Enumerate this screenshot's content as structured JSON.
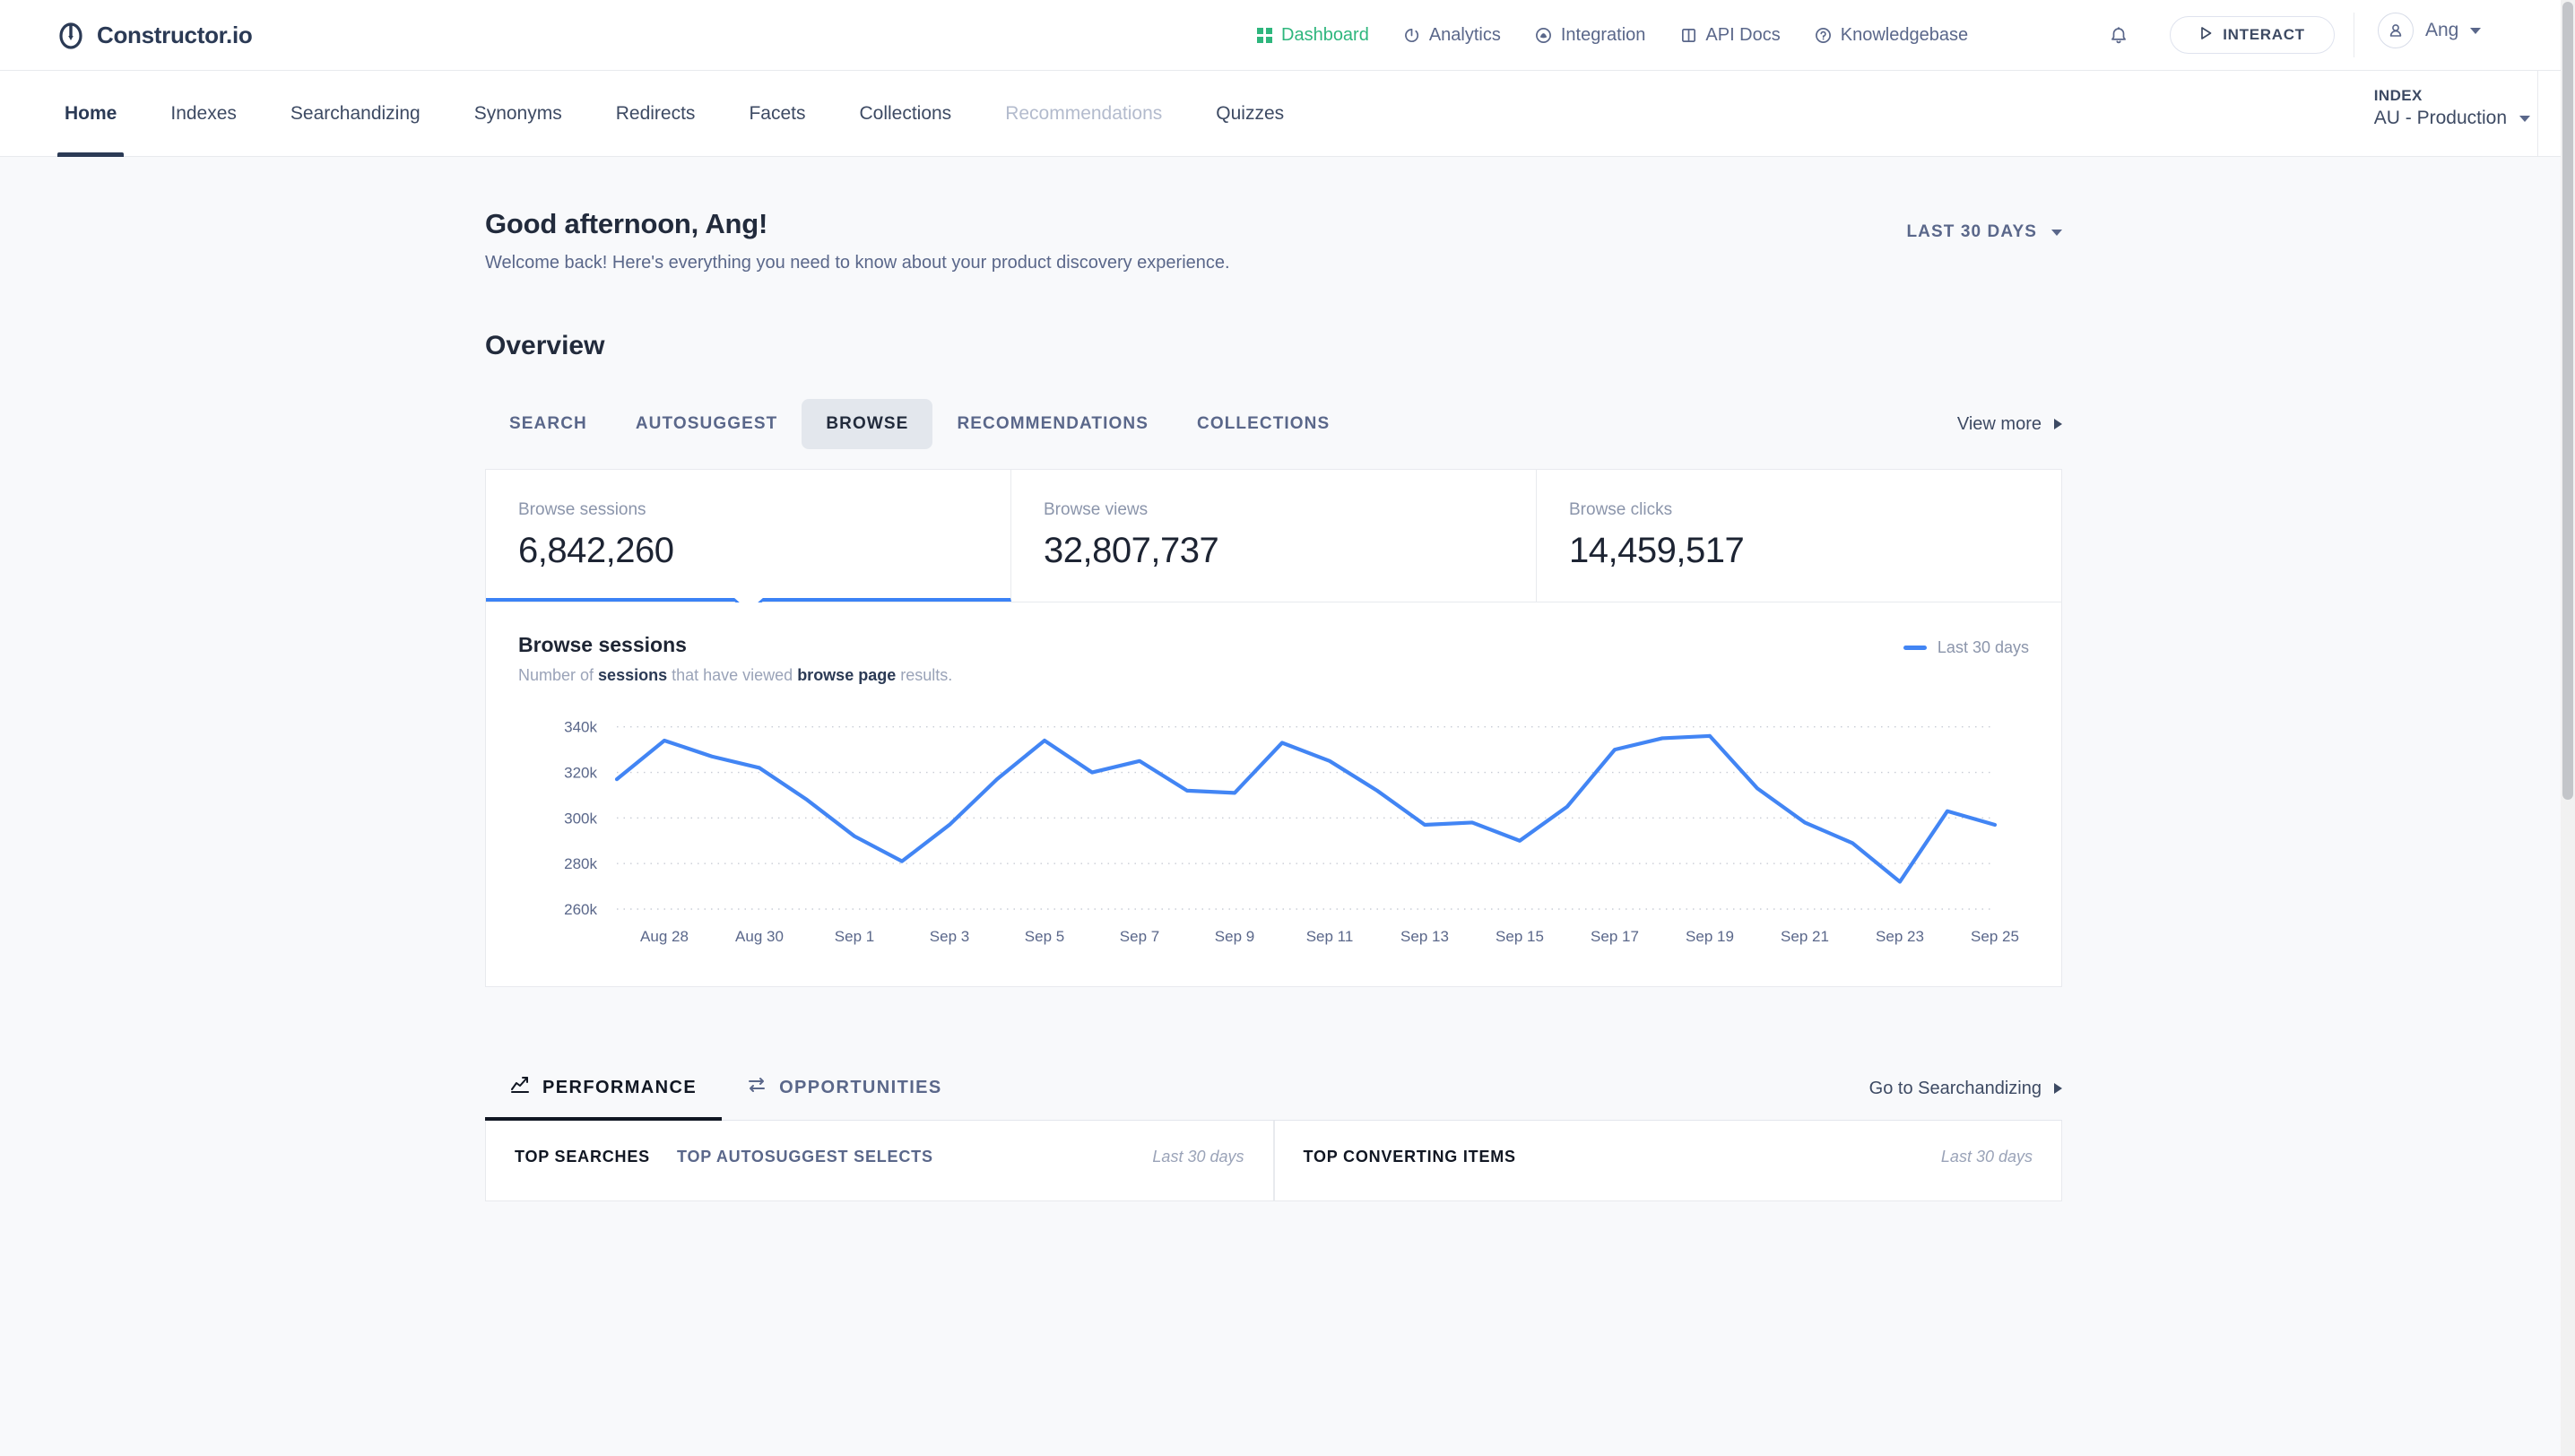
{
  "brand": {
    "name": "Constructor.io",
    "logo_icon": "constructor-logo-icon"
  },
  "topnav": {
    "items": [
      {
        "label": "Dashboard",
        "icon": "dashboard-icon",
        "active": true
      },
      {
        "label": "Analytics",
        "icon": "analytics-icon",
        "active": false
      },
      {
        "label": "Integration",
        "icon": "integration-icon",
        "active": false
      },
      {
        "label": "API Docs",
        "icon": "api-docs-icon",
        "active": false
      },
      {
        "label": "Knowledgebase",
        "icon": "knowledgebase-icon",
        "active": false
      }
    ],
    "notifications_icon": "bell-icon",
    "interact_label": "INTERACT",
    "interact_icon": "play-icon",
    "user_name": "Ang",
    "avatar_icon": "user-avatar-icon",
    "active_color": "#2eb67d"
  },
  "subnav": {
    "items": [
      {
        "label": "Home",
        "state": "active"
      },
      {
        "label": "Indexes",
        "state": "normal"
      },
      {
        "label": "Searchandizing",
        "state": "normal"
      },
      {
        "label": "Synonyms",
        "state": "normal"
      },
      {
        "label": "Redirects",
        "state": "normal"
      },
      {
        "label": "Facets",
        "state": "normal"
      },
      {
        "label": "Collections",
        "state": "normal"
      },
      {
        "label": "Recommendations",
        "state": "disabled"
      },
      {
        "label": "Quizzes",
        "state": "normal"
      }
    ],
    "index_label": "INDEX",
    "index_value": "AU - Production"
  },
  "greeting": {
    "title": "Good afternoon, Ang!",
    "subtitle": "Welcome back! Here's everything you need to know about your product discovery experience.",
    "date_range": "LAST 30 DAYS"
  },
  "overview": {
    "heading": "Overview",
    "tabs": [
      {
        "label": "SEARCH",
        "active": false
      },
      {
        "label": "AUTOSUGGEST",
        "active": false
      },
      {
        "label": "BROWSE",
        "active": true
      },
      {
        "label": "RECOMMENDATIONS",
        "active": false
      },
      {
        "label": "COLLECTIONS",
        "active": false
      }
    ],
    "view_more": "View more",
    "metrics": [
      {
        "label": "Browse sessions",
        "value": "6,842,260",
        "selected": true
      },
      {
        "label": "Browse views",
        "value": "32,807,737",
        "selected": false
      },
      {
        "label": "Browse clicks",
        "value": "14,459,517",
        "selected": false
      }
    ]
  },
  "chart_panel": {
    "title": "Browse sessions",
    "subtitle_parts": [
      "Number of ",
      "sessions",
      " that have viewed ",
      "browse page",
      " results."
    ],
    "legend_label": "Last 30 days",
    "line_color": "#4285f4"
  },
  "chart_data": {
    "type": "line",
    "title": "Browse sessions",
    "xlabel": "",
    "ylabel": "",
    "ylim": [
      260000,
      345000
    ],
    "ytick_labels": [
      "260k",
      "280k",
      "300k",
      "320k",
      "340k"
    ],
    "ytick_values": [
      260000,
      280000,
      300000,
      320000,
      340000
    ],
    "grid": true,
    "legend_position": "top-right",
    "x_tick_labels": [
      "Aug 28",
      "Aug 30",
      "Sep 1",
      "Sep 3",
      "Sep 5",
      "Sep 7",
      "Sep 9",
      "Sep 11",
      "Sep 13",
      "Sep 15",
      "Sep 17",
      "Sep 19",
      "Sep 21",
      "Sep 23",
      "Sep 25"
    ],
    "series": [
      {
        "name": "Last 30 days",
        "x": [
          "Aug 27",
          "Aug 28",
          "Aug 29",
          "Aug 30",
          "Aug 31",
          "Sep 1",
          "Sep 2",
          "Sep 3",
          "Sep 4",
          "Sep 5",
          "Sep 6",
          "Sep 7",
          "Sep 8",
          "Sep 9",
          "Sep 10",
          "Sep 11",
          "Sep 12",
          "Sep 13",
          "Sep 14",
          "Sep 15",
          "Sep 16",
          "Sep 17",
          "Sep 18",
          "Sep 19",
          "Sep 20",
          "Sep 21",
          "Sep 22",
          "Sep 23",
          "Sep 24",
          "Sep 25"
        ],
        "values": [
          317000,
          334000,
          327000,
          322000,
          308000,
          292000,
          281000,
          297000,
          317000,
          334000,
          320000,
          325000,
          312000,
          311000,
          333000,
          325000,
          312000,
          297000,
          298000,
          290000,
          305000,
          330000,
          335000,
          336000,
          313000,
          298000,
          289000,
          272000,
          303000,
          297000
        ]
      }
    ]
  },
  "bottom": {
    "tabs": [
      {
        "label": "PERFORMANCE",
        "icon": "performance-icon",
        "active": true
      },
      {
        "label": "OPPORTUNITIES",
        "icon": "opportunities-icon",
        "active": false
      }
    ],
    "go_to_searchandizing": "Go to Searchandizing",
    "left_card": {
      "tabs": [
        {
          "label": "TOP SEARCHES",
          "active": true
        },
        {
          "label": "TOP AUTOSUGGEST SELECTS",
          "active": false
        }
      ],
      "range": "Last 30 days"
    },
    "right_card": {
      "tabs": [
        {
          "label": "TOP CONVERTING ITEMS",
          "active": true
        }
      ],
      "range": "Last 30 days"
    }
  }
}
